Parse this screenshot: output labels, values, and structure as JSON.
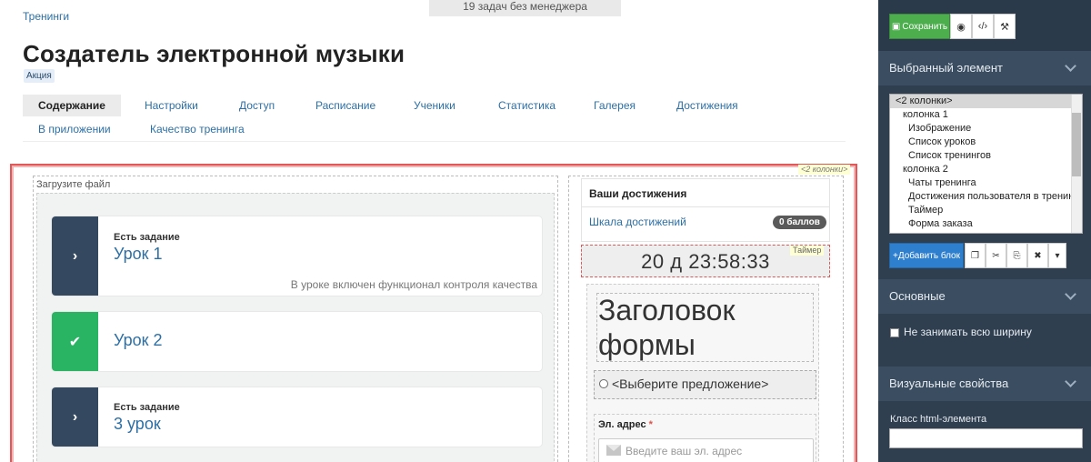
{
  "banner": {
    "text": "19 задач без менеджера"
  },
  "breadcrumb": {
    "text": "Тренинги"
  },
  "page": {
    "title": "Создатель электронной музыки",
    "tag": "Акция"
  },
  "tabs": [
    "Содержание",
    "Настройки",
    "Доступ",
    "Расписание",
    "Ученики",
    "Статистика",
    "Галерея",
    "Достижения",
    "В приложении",
    "Качество тренинга"
  ],
  "editor": {
    "columns_tag": "<2 колонки>",
    "upload_label": "Загрузите файл",
    "lessons": [
      {
        "assignment": "Есть задание",
        "title": "Урок 1",
        "note": "В уроке включен функционал контроля качества",
        "icon": "chevron-right",
        "color": "#34485f"
      },
      {
        "assignment": "",
        "title": "Урок 2",
        "note": "",
        "icon": "check",
        "color": "#28b463"
      },
      {
        "assignment": "Есть задание",
        "title": "3 урок",
        "note": "",
        "icon": "chevron-right",
        "color": "#34485f"
      }
    ],
    "achievements": {
      "title": "Ваши достижения",
      "link": "Шкала достижений",
      "points": "0 баллов"
    },
    "timer": {
      "tag": "Таймер",
      "value": "20 д 23:58:33"
    },
    "form": {
      "title": "Заголовок формы",
      "offer_label": "<Выберите предложение>",
      "email_label": "Эл. адрес",
      "email_required": "*",
      "email_placeholder": "Введите ваш эл. адрес"
    }
  },
  "sidebar": {
    "save_label": "Сохранить",
    "selected_section": "Выбранный элемент",
    "tree": [
      {
        "label": "<2 колонки>",
        "level": 0,
        "selected": true
      },
      {
        "label": "колонка 1",
        "level": 1
      },
      {
        "label": "Изображение",
        "level": 2
      },
      {
        "label": "Список уроков",
        "level": 2
      },
      {
        "label": "Список тренингов",
        "level": 2
      },
      {
        "label": "колонка 2",
        "level": 1
      },
      {
        "label": "Чаты тренинга",
        "level": 2
      },
      {
        "label": "Достижения пользователя в тренинге",
        "level": 2
      },
      {
        "label": "Таймер",
        "level": 2
      },
      {
        "label": "Форма заказа",
        "level": 2
      }
    ],
    "add_block_label": "Добавить блок",
    "basic_section": "Основные",
    "fullwidth_label": "Не занимать всю ширину",
    "visual_section": "Визуальные свойства",
    "class_label": "Класс html-элемента"
  },
  "colors": {
    "accent": "#2d6fa4",
    "save": "#4cae4c",
    "sidebar": "#2f3f50",
    "frame": "#e25858"
  }
}
